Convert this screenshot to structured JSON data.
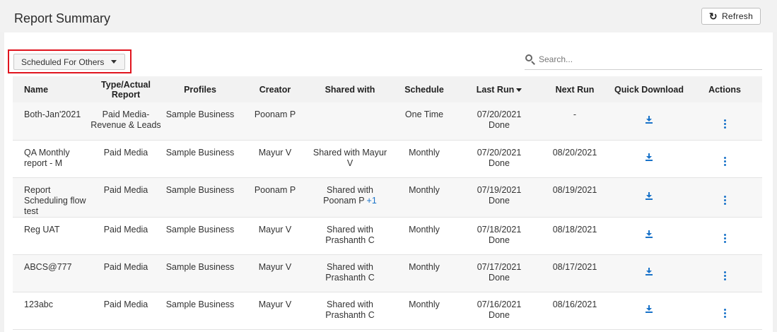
{
  "header": {
    "title": "Report Summary",
    "refresh_label": "Refresh"
  },
  "filter": {
    "selected": "Scheduled For Others"
  },
  "search": {
    "placeholder": "Search..."
  },
  "columns": [
    "Name",
    "Type/Actual Report",
    "Profiles",
    "Creator",
    "Shared with",
    "Schedule",
    "Last Run",
    "Next Run",
    "Quick Download",
    "Actions"
  ],
  "rows": [
    {
      "name": "Both-Jan'2021",
      "type": "Paid Media-Revenue & Leads",
      "profile": "Sample Business",
      "creator": "Poonam P",
      "shared": "",
      "shared_extra": "",
      "schedule": "One Time",
      "last_run_date": "07/20/2021",
      "last_run_status": "Done",
      "next_run": "-"
    },
    {
      "name": "QA Monthly report - M",
      "type": "Paid Media",
      "profile": "Sample Business",
      "creator": "Mayur V",
      "shared": "Shared with Mayur V",
      "shared_extra": "",
      "schedule": "Monthly",
      "last_run_date": "07/20/2021",
      "last_run_status": "Done",
      "next_run": "08/20/2021"
    },
    {
      "name": "Report Scheduling flow test",
      "type": "Paid Media",
      "profile": "Sample Business",
      "creator": "Poonam P",
      "shared": "Shared with Poonam P",
      "shared_extra": "+1",
      "schedule": "Monthly",
      "last_run_date": "07/19/2021",
      "last_run_status": "Done",
      "next_run": "08/19/2021"
    },
    {
      "name": "Reg UAT",
      "type": "Paid Media",
      "profile": "Sample Business",
      "creator": "Mayur V",
      "shared": "Shared with Prashanth C",
      "shared_extra": "",
      "schedule": "Monthly",
      "last_run_date": "07/18/2021",
      "last_run_status": "Done",
      "next_run": "08/18/2021"
    },
    {
      "name": "ABCS@777",
      "type": "Paid Media",
      "profile": "Sample Business",
      "creator": "Mayur V",
      "shared": "Shared with Prashanth C",
      "shared_extra": "",
      "schedule": "Monthly",
      "last_run_date": "07/17/2021",
      "last_run_status": "Done",
      "next_run": "08/17/2021"
    },
    {
      "name": "123abc",
      "type": "Paid Media",
      "profile": "Sample Business",
      "creator": "Mayur V",
      "shared": "Shared with Prashanth C",
      "shared_extra": "",
      "schedule": "Monthly",
      "last_run_date": "07/16/2021",
      "last_run_status": "Done",
      "next_run": "08/16/2021"
    }
  ],
  "colors": {
    "accent": "#1a73c9",
    "highlight": "#e0141e"
  }
}
